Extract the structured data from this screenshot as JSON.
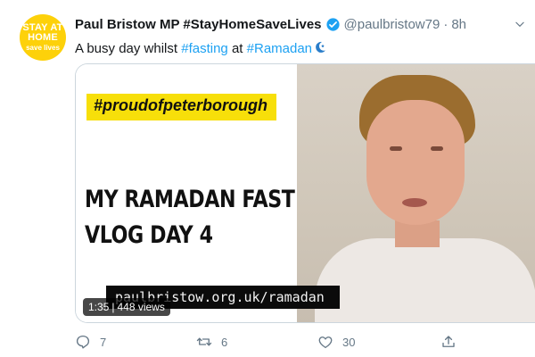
{
  "avatar": {
    "line1": "STAY AT",
    "line2": "HOME",
    "line3": "save lives"
  },
  "tweet": {
    "author_name": "Paul Bristow MP #StayHomeSaveLives",
    "handle": "@paulbristow79",
    "separator": "·",
    "time": "8h",
    "text_part1": "A busy day whilst ",
    "hashtag1": "#fasting",
    "text_part2": " at ",
    "hashtag2": "#Ramadan"
  },
  "video": {
    "banner": "#proudofpeterborough",
    "headline_line1": "MY RAMADAN FAST",
    "headline_line2": "VLOG DAY 4",
    "url_caption": "paulbristow.org.uk/ramadan",
    "duration": "1:35",
    "separator": "|",
    "views": "448 views"
  },
  "actions": {
    "reply_count": "7",
    "retweet_count": "6",
    "like_count": "30"
  },
  "colors": {
    "accent": "#1da1f2",
    "muted": "#657786",
    "avatar_yellow": "#fdd10a",
    "banner_yellow": "#f7df0a"
  }
}
